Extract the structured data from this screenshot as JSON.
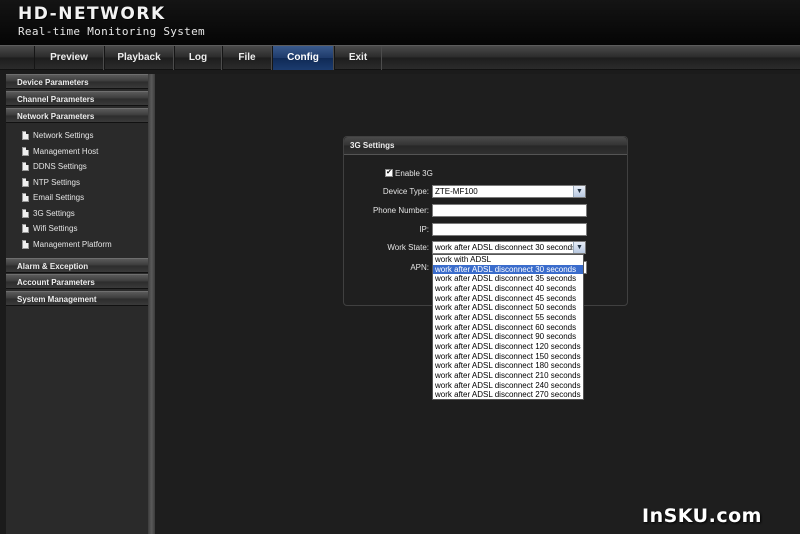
{
  "header": {
    "logo": "HD-NETWORK",
    "subtitle": "Real-time Monitoring System"
  },
  "nav": {
    "tabs": [
      {
        "label": "Preview"
      },
      {
        "label": "Playback"
      },
      {
        "label": "Log"
      },
      {
        "label": "File"
      },
      {
        "label": "Config"
      },
      {
        "label": "Exit"
      }
    ],
    "active": "Config"
  },
  "sidebar": {
    "categories": [
      {
        "label": "Device Parameters"
      },
      {
        "label": "Channel Parameters"
      },
      {
        "label": "Network Parameters"
      },
      {
        "label": "Alarm & Exception"
      },
      {
        "label": "Account Parameters"
      },
      {
        "label": "System Management"
      }
    ],
    "network_items": [
      {
        "label": "Network Settings",
        "icon": "document-icon"
      },
      {
        "label": "Management Host",
        "icon": "document-icon"
      },
      {
        "label": "DDNS Settings",
        "icon": "document-icon"
      },
      {
        "label": "NTP Settings",
        "icon": "document-icon"
      },
      {
        "label": "Email Settings",
        "icon": "document-icon"
      },
      {
        "label": "3G Settings",
        "icon": "document-icon"
      },
      {
        "label": "Wifi Settings",
        "icon": "document-icon"
      },
      {
        "label": "Management Platform",
        "icon": "document-icon"
      }
    ]
  },
  "panel": {
    "title": "3G Settings",
    "enable_3g": {
      "label": "Enable 3G",
      "checked": true
    },
    "device_type": {
      "label": "Device Type:",
      "value": "ZTE-MF100"
    },
    "phone_number": {
      "label": "Phone Number:",
      "value": ""
    },
    "ip": {
      "label": "IP:",
      "value": ""
    },
    "work_state": {
      "label": "Work State:",
      "value": "work after ADSL disconnect 30 seconds"
    },
    "apn": {
      "label": "APN:",
      "value": ""
    }
  },
  "work_state_options": [
    "work with ADSL",
    "work after ADSL disconnect 30 seconds",
    "work after ADSL disconnect 35 seconds",
    "work after ADSL disconnect 40 seconds",
    "work after ADSL disconnect 45 seconds",
    "work after ADSL disconnect 50 seconds",
    "work after ADSL disconnect 55 seconds",
    "work after ADSL disconnect 60 seconds",
    "work after ADSL disconnect 90 seconds",
    "work after ADSL disconnect 120 seconds",
    "work after ADSL disconnect 150 seconds",
    "work after ADSL disconnect 180 seconds",
    "work after ADSL disconnect 210 seconds",
    "work after ADSL disconnect 240 seconds",
    "work after ADSL disconnect 270 seconds"
  ],
  "work_state_selected_index": 1,
  "watermark": "InSKU.com",
  "colors": {
    "active_tab": "#1e3a6a",
    "selected_option": "#3a6ccc",
    "background": "#1b1b1b"
  }
}
